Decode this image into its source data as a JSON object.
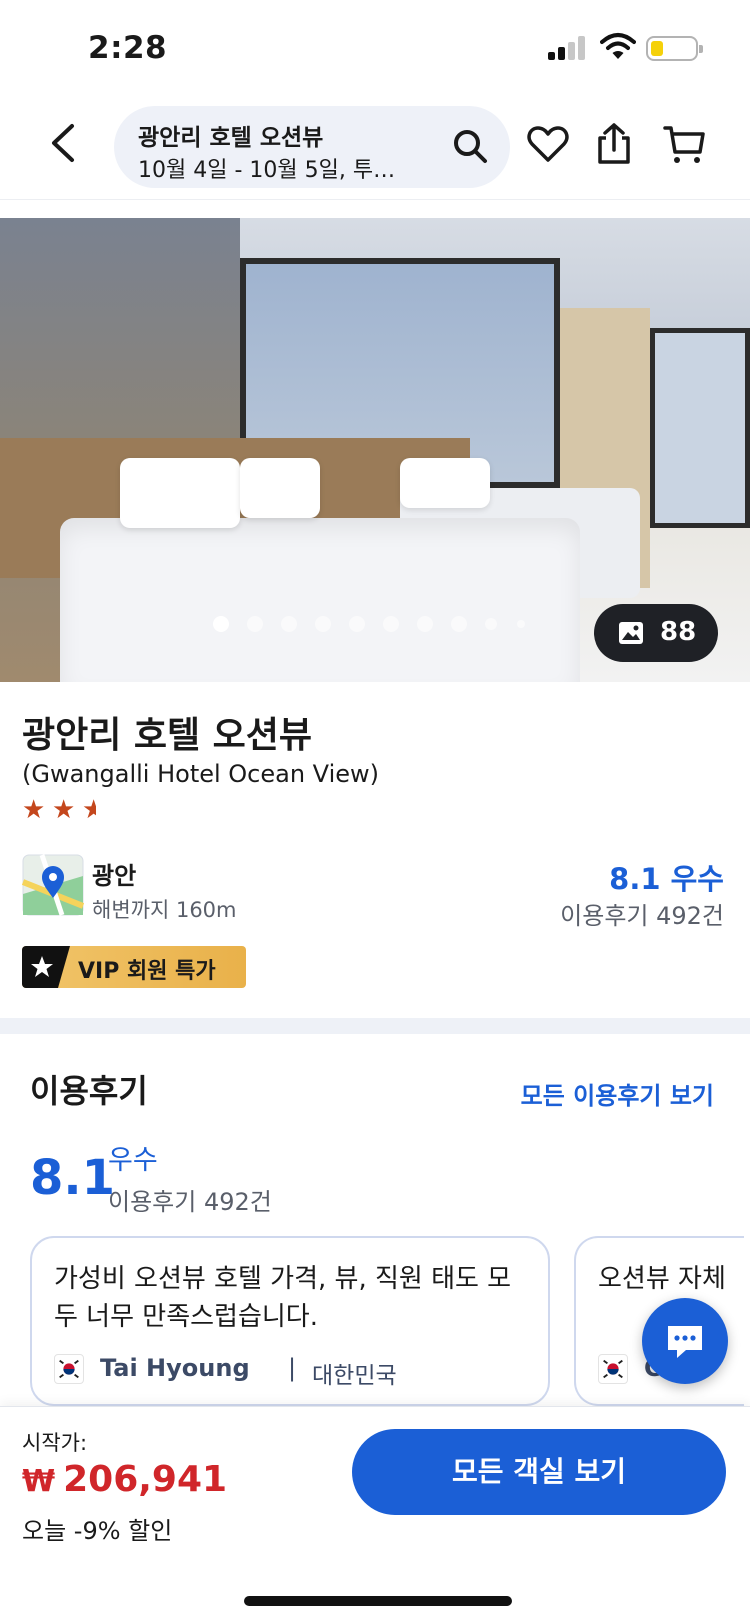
{
  "status_bar": {
    "time": "2:28"
  },
  "header": {
    "search_title": "광안리 호텔 오션뷰",
    "search_subtitle": "10월 4일 - 10월 5일, 투…",
    "icons": [
      "back-arrow-icon",
      "search-icon",
      "heart-icon",
      "share-icon",
      "cart-icon"
    ]
  },
  "gallery": {
    "photo_count": "88",
    "dot_count": 10,
    "active_dot": 0
  },
  "hotel": {
    "name": "광안리 호텔 오션뷰",
    "name_en": "(Gwangalli Hotel Ocean View)",
    "star_rating": 2.5,
    "area": "광안",
    "distance": "해변까지 160m",
    "score": "8.1 우수",
    "review_count": "이용후기 492건",
    "badge": "VIP 회원 특가"
  },
  "reviews": {
    "title": "이용후기",
    "see_all": "모든 이용후기 보기",
    "score": "8.1",
    "grade": "우수",
    "count": "이용후기 492건",
    "cards": [
      {
        "text": "가성비 오션뷰 호텔 가격, 뷰, 직원 태도 모두 너무 만족스럽습니다.",
        "author": "Tai Hyoung",
        "separator": "|",
        "country": "대한민국"
      },
      {
        "text": "오션뷰 자체",
        "author": "C",
        "separator": "",
        "country": ""
      }
    ]
  },
  "bottom": {
    "price_label": "시작가:",
    "currency": "₩",
    "price": "206,941",
    "discount": "오늘 -9% 할인",
    "cta": "모든 객실 보기"
  },
  "colors": {
    "accent": "#1b5fd6",
    "price_red": "#d0262a",
    "star": "#c4471d",
    "vip_gold": "#e9b14a"
  }
}
